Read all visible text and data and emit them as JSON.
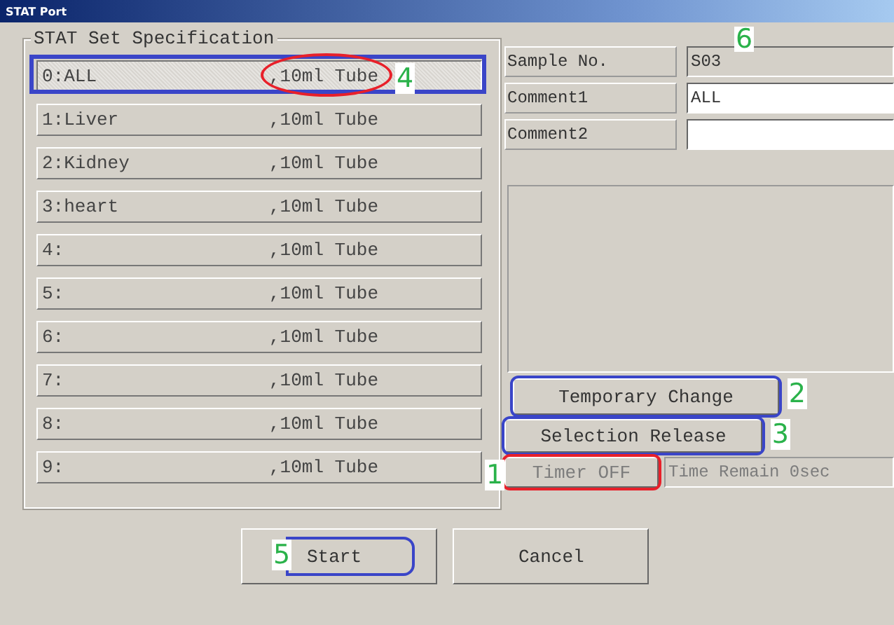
{
  "window": {
    "title": "STAT Port"
  },
  "stat_set": {
    "title": "STAT Set Specification",
    "items": [
      {
        "label": "0:ALL",
        "tube": ",10ml Tube",
        "selected": true,
        "callout": {
          "color": "#3a45c8"
        },
        "tube_callout": {
          "color": "#e8202a",
          "number": "4"
        }
      },
      {
        "label": "1:Liver",
        "tube": ",10ml Tube",
        "selected": false
      },
      {
        "label": "2:Kidney",
        "tube": ",10ml Tube",
        "selected": false
      },
      {
        "label": "3:heart",
        "tube": ",10ml Tube",
        "selected": false
      },
      {
        "label": "4:",
        "tube": ",10ml Tube",
        "selected": false
      },
      {
        "label": "5:",
        "tube": ",10ml Tube",
        "selected": false
      },
      {
        "label": "6:",
        "tube": ",10ml Tube",
        "selected": false
      },
      {
        "label": "7:",
        "tube": ",10ml Tube",
        "selected": false
      },
      {
        "label": "8:",
        "tube": ",10ml Tube",
        "selected": false
      },
      {
        "label": "9:",
        "tube": ",10ml Tube",
        "selected": false
      }
    ]
  },
  "fields": [
    {
      "label": "Sample No.",
      "value": "S03",
      "editable": false,
      "callout": {
        "number": "6"
      }
    },
    {
      "label": "Comment1",
      "value": "ALL",
      "editable": true
    },
    {
      "label": "Comment2",
      "editable": true
    }
  ],
  "temporary_change": {
    "label": "Temporary Change",
    "callout": {
      "color": "#3a45c8",
      "number": "2"
    }
  },
  "selection_release": {
    "label": "Selection Release",
    "callout": {
      "color": "#3a45c8",
      "number": "3"
    }
  },
  "timer": {
    "label": "Timer OFF",
    "disabled": true,
    "callout": {
      "color": "#e8202a",
      "number": "1"
    },
    "remain": "Time Remain 0sec"
  },
  "buttons": [
    {
      "label": "Start",
      "callout": {
        "color": "#3a45c8",
        "number": "5"
      }
    },
    {
      "label": "Cancel"
    }
  ]
}
